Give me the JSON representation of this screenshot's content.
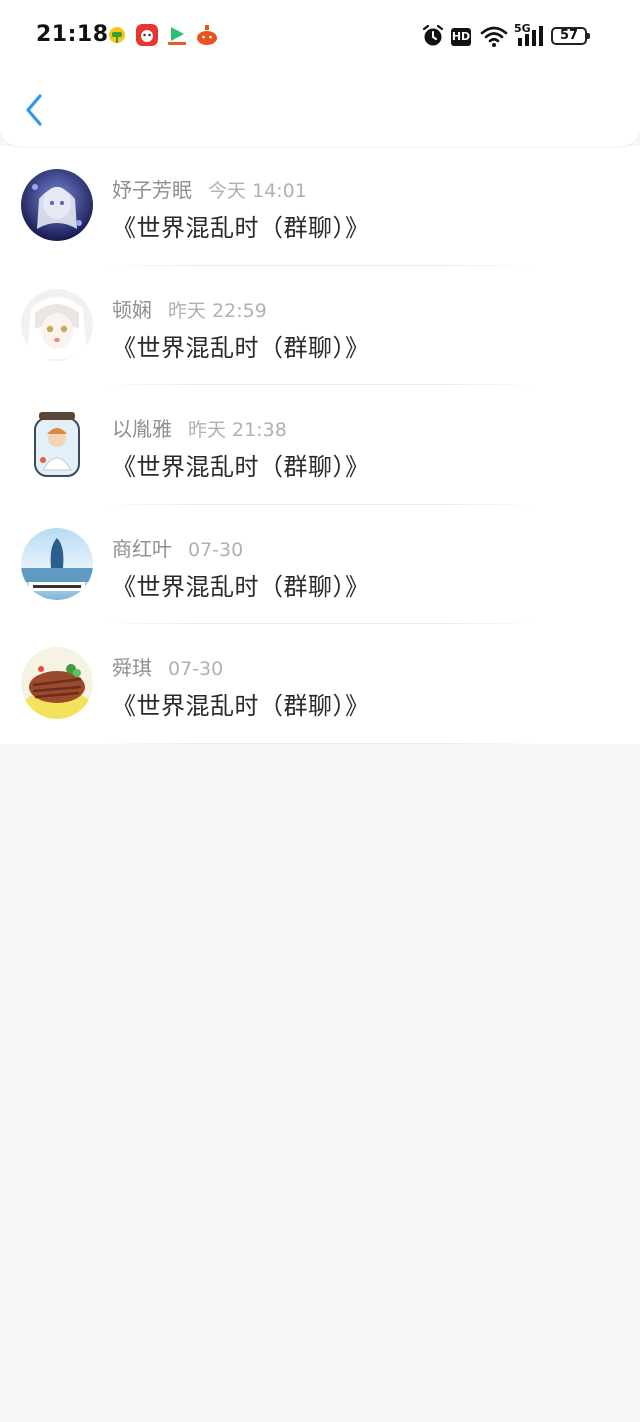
{
  "status_bar": {
    "time": "21:18",
    "battery": "57",
    "network": "5G",
    "hd": "HD"
  },
  "nav": {
    "back_icon": "chevron-left-icon",
    "accent_color": "#2a9af3"
  },
  "messages": [
    {
      "name": "妤子芳眠",
      "time": "今天 14:01",
      "text": "《世界混乱时（群聊）》"
    },
    {
      "name": "顿娴",
      "time": "昨天 22:59",
      "text": "《世界混乱时（群聊）》"
    },
    {
      "name": "以胤雅",
      "time": "昨天 21:38",
      "text": "《世界混乱时（群聊）》"
    },
    {
      "name": "商红叶",
      "time": "07-30",
      "text": "《世界混乱时（群聊）》"
    },
    {
      "name": "舜琪",
      "time": "07-30",
      "text": "《世界混乱时（群聊）》"
    }
  ]
}
